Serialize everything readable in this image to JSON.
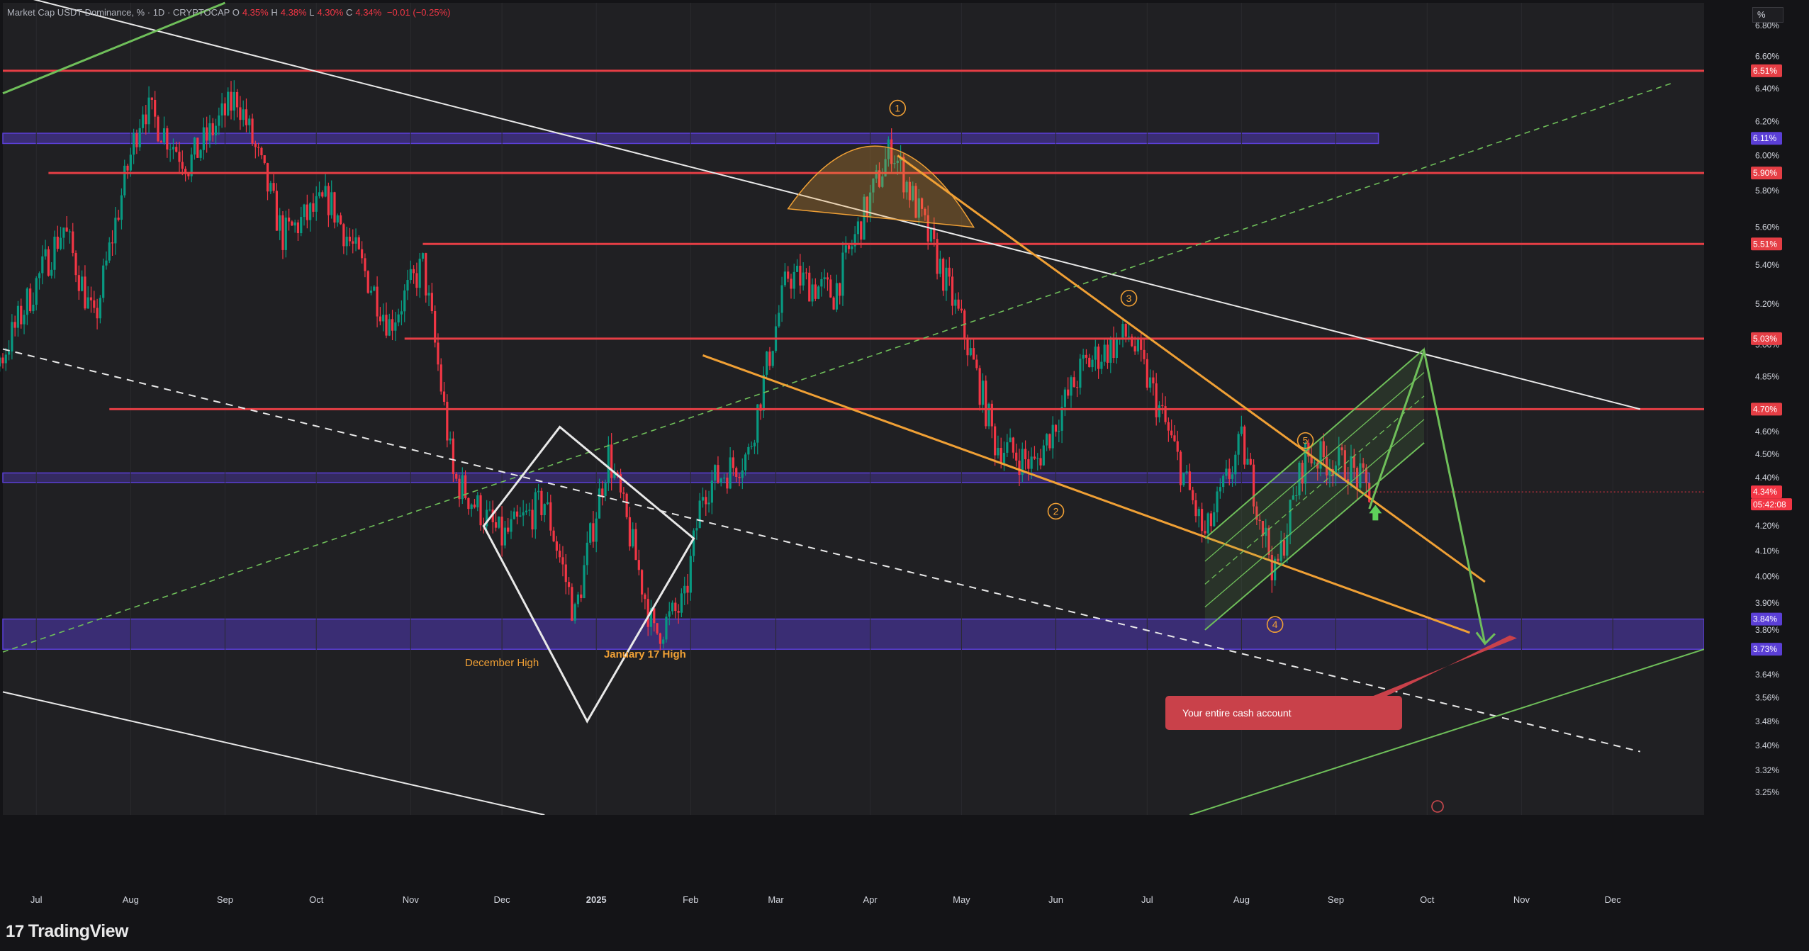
{
  "header": {
    "symbol": "Market Cap USDT Dominance, %",
    "interval": "1D",
    "source": "CRYPTOCAP",
    "open_label": "O",
    "open": "4.35%",
    "high_label": "H",
    "high": "4.38%",
    "low_label": "L",
    "low": "4.30%",
    "close_label": "C",
    "close": "4.34%",
    "change": "−0.01 (−0.25%)"
  },
  "scale_button": "%",
  "brand": "TradingView",
  "colors": {
    "background": "#141417",
    "up": "#089981",
    "down": "#f23645",
    "resistance": "#e53e45",
    "zone": "#5b3fd6",
    "trend_orange": "#f0a035",
    "channel_green": "#6fbf5a",
    "white_lines": "#e8e8e8"
  },
  "chart_data": {
    "type": "candlestick",
    "title": "Market Cap USDT Dominance, % · 1D · CRYPTOCAP",
    "ylabel": "%",
    "y_scale": "log",
    "ylim": [
      3.18,
      6.95
    ],
    "x_ticks": [
      "Jul",
      "Aug",
      "Sep",
      "Oct",
      "Nov",
      "Dec",
      "2025",
      "Feb",
      "Mar",
      "Apr",
      "May",
      "Jun",
      "Jul",
      "Aug",
      "Sep",
      "Oct",
      "Nov",
      "Dec"
    ],
    "y_ticks": [
      "3.25%",
      "3.32%",
      "3.40%",
      "3.48%",
      "3.56%",
      "3.64%",
      "3.80%",
      "3.90%",
      "4.00%",
      "4.10%",
      "4.20%",
      "4.40%",
      "4.50%",
      "4.60%",
      "4.85%",
      "5.00%",
      "5.20%",
      "5.40%",
      "5.60%",
      "5.80%",
      "6.00%",
      "6.20%",
      "6.40%",
      "6.60%",
      "6.80%"
    ],
    "price_anchors": [
      [
        "2024-06-01",
        4.7
      ],
      [
        "2024-06-20",
        4.95
      ],
      [
        "2024-07-10",
        5.6
      ],
      [
        "2024-07-20",
        5.1
      ],
      [
        "2024-08-05",
        6.3
      ],
      [
        "2024-08-20",
        5.95
      ],
      [
        "2024-09-05",
        6.35
      ],
      [
        "2024-09-20",
        5.55
      ],
      [
        "2024-10-05",
        5.75
      ],
      [
        "2024-10-25",
        5.1
      ],
      [
        "2024-11-05",
        5.4
      ],
      [
        "2024-11-15",
        4.4
      ],
      [
        "2024-12-01",
        4.15
      ],
      [
        "2024-12-15",
        4.3
      ],
      [
        "2024-12-25",
        3.85
      ],
      [
        "2025-01-05",
        4.5
      ],
      [
        "2025-01-20",
        3.78
      ],
      [
        "2025-01-30",
        3.9
      ],
      [
        "2025-02-05",
        4.35
      ],
      [
        "2025-02-20",
        4.5
      ],
      [
        "2025-03-05",
        5.35
      ],
      [
        "2025-03-20",
        5.25
      ],
      [
        "2025-04-08",
        6.05
      ],
      [
        "2025-04-20",
        5.55
      ],
      [
        "2025-05-01",
        5.1
      ],
      [
        "2025-05-12",
        4.55
      ],
      [
        "2025-05-25",
        4.45
      ],
      [
        "2025-06-10",
        4.9
      ],
      [
        "2025-06-25",
        5.05
      ],
      [
        "2025-07-05",
        4.7
      ],
      [
        "2025-07-20",
        4.15
      ],
      [
        "2025-08-01",
        4.55
      ],
      [
        "2025-08-12",
        4.0
      ],
      [
        "2025-08-22",
        4.5
      ],
      [
        "2025-09-05",
        4.45
      ],
      [
        "2025-09-12",
        4.34
      ]
    ],
    "x_window": [
      "2024-06-20",
      "2025-12-31"
    ],
    "last_price": "4.34%",
    "countdown": "05:42:08",
    "horizontal_levels": [
      {
        "price": 6.51,
        "label": "6.51%",
        "from": "2024-06-20"
      },
      {
        "price": 5.9,
        "label": "5.90%",
        "from": "2024-07-05"
      },
      {
        "price": 5.51,
        "label": "5.51%",
        "from": "2024-11-05"
      },
      {
        "price": 5.03,
        "label": "5.03%",
        "from": "2024-10-30"
      },
      {
        "price": 4.7,
        "label": "4.70%",
        "from": "2024-07-25"
      }
    ],
    "zones": [
      {
        "top": 6.13,
        "bottom": 6.07,
        "label": "6.11%",
        "to": "2025-09-15"
      },
      {
        "top": 4.42,
        "bottom": 4.38,
        "label": "",
        "to": "2025-09-12"
      },
      {
        "top": 3.84,
        "bottom": 3.73,
        "label_top": "3.84%",
        "label_bottom": "3.73%",
        "to": "2025-12-31"
      }
    ],
    "trendlines": {
      "white_upper": [
        [
          "2024-06-25",
          7.0
        ],
        [
          "2025-12-10",
          4.7
        ]
      ],
      "white_dashed": [
        [
          "2024-06-20",
          4.98
        ],
        [
          "2025-12-10",
          3.38
        ]
      ],
      "white_lower": [
        [
          "2024-06-20",
          3.58
        ],
        [
          "2024-12-15",
          3.18
        ]
      ],
      "green_top": [
        [
          "2024-06-20",
          6.37
        ],
        [
          "2024-09-01",
          6.95
        ]
      ],
      "green_dashed": [
        [
          "2024-06-20",
          3.72
        ],
        [
          "2025-12-20",
          6.43
        ]
      ],
      "green_bottom": [
        [
          "2025-07-15",
          3.18
        ],
        [
          "2025-12-31",
          3.73
        ]
      ],
      "orange_a": [
        [
          "2025-04-10",
          6.0
        ],
        [
          "2025-10-20",
          3.98
        ]
      ],
      "orange_b": [
        [
          "2025-02-05",
          4.95
        ],
        [
          "2025-10-15",
          3.79
        ]
      ]
    },
    "annotations": [
      {
        "text": "December High",
        "date": "2024-12-01",
        "price": 3.67
      },
      {
        "text": "January 17 High",
        "date": "2025-01-17",
        "price": 3.7
      },
      {
        "text": "1",
        "date": "2025-04-10",
        "price": 6.28
      },
      {
        "text": "2",
        "date": "2025-06-01",
        "price": 4.26
      },
      {
        "text": "3",
        "date": "2025-06-25",
        "price": 5.23
      },
      {
        "text": "4",
        "date": "2025-08-12",
        "price": 3.82
      },
      {
        "text": "5",
        "date": "2025-08-22",
        "price": 4.56
      }
    ],
    "callout": "Your entire cash account"
  }
}
